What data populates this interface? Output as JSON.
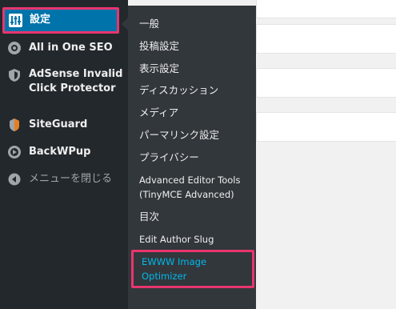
{
  "sidebar": {
    "settings_label": "設定",
    "items": [
      {
        "label": "All in One SEO",
        "icon": "gear-circle-icon"
      },
      {
        "label": "AdSense Invalid",
        "label2": "Click Protector",
        "icon": "shield-icon"
      },
      {
        "label": "SiteGuard",
        "icon": "siteguard-icon"
      },
      {
        "label": "BackWPup",
        "icon": "backwpup-icon"
      }
    ],
    "collapse_label": "メニューを閉じる"
  },
  "submenu": {
    "items": [
      "一般",
      "投稿設定",
      "表示設定",
      "ディスカッション",
      "メディア",
      "パーマリンク設定",
      "プライバシー"
    ],
    "advanced_line1": "Advanced Editor Tools",
    "advanced_line2": "(TinyMCE Advanced)",
    "toc": "目次",
    "edit_author_slug": "Edit Author Slug",
    "ewww_line1": "EWWW Image",
    "ewww_line2": "Optimizer"
  },
  "colors": {
    "sidebar_bg": "#23282d",
    "submenu_bg": "#32373c",
    "highlight": "#e9356f",
    "active_link": "#00b9eb",
    "settings_active_bg": "#0073aa"
  }
}
